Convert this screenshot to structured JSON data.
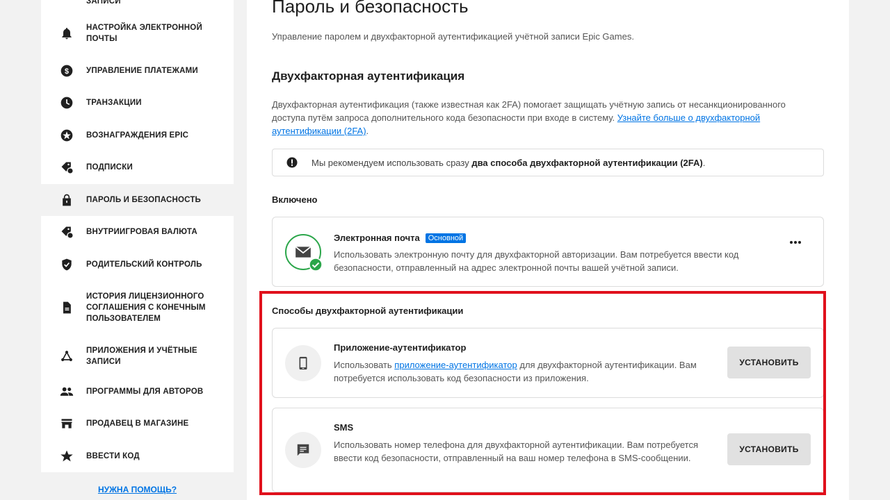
{
  "sidebar": {
    "items": [
      {
        "label": "Настройка электронной почты",
        "icon": "bell-icon"
      },
      {
        "label": "Управление платежами",
        "icon": "dollar-circle-icon"
      },
      {
        "label": "Транзакции",
        "icon": "clock-icon"
      },
      {
        "label": "Вознаграждения Epic",
        "icon": "rewards-icon"
      },
      {
        "label": "Подписки",
        "icon": "subscription-tag-icon"
      },
      {
        "label": "Пароль и безопасность",
        "icon": "lock-icon",
        "active": true
      },
      {
        "label": "Внутриигровая валюта",
        "icon": "currency-tag-icon"
      },
      {
        "label": "Родительский контроль",
        "icon": "shield-check-icon"
      },
      {
        "label": "История лицензионного соглашения с конечным пользователем",
        "icon": "document-icon"
      },
      {
        "label": "Приложения и учётные записи",
        "icon": "connections-icon"
      },
      {
        "label": "Программы для авторов",
        "icon": "people-icon"
      },
      {
        "label": "Продавец в магазине",
        "icon": "store-icon"
      },
      {
        "label": "Ввести код",
        "icon": "star-icon"
      }
    ],
    "help_link": "Нужна помощь?"
  },
  "main": {
    "title": "Пароль и безопасность",
    "subtitle": "Управление паролем и двухфакторной аутентификацией учётной записи Epic Games.",
    "twofa_title": "Двухфакторная аутентификация",
    "twofa_desc": "Двухфакторная аутентификация (также известная как 2FA) помогает защищать учётную запись от несанкционированного доступа путём запроса дополнительного кода безопасности при входе в систему.",
    "twofa_link": "Узнайте больше о двухфакторной аутентификации (2FA)",
    "notice_prefix": "Мы рекомендуем использовать сразу",
    "notice_bold": "два способа двухфакторной аутентификации (2FA)",
    "enabled_label": "Включено",
    "email_method": {
      "title": "Электронная почта",
      "badge": "Основной",
      "desc": "Использовать электронную почту для двухфакторной авторизации. Вам потребуется ввести код безопасности, отправленный на адрес электронной почты вашей учётной записи.",
      "status_color": "#2ba64a"
    },
    "methods_label": "Способы двухфакторной аутентификации",
    "methods": [
      {
        "title": "Приложение-аутентификатор",
        "desc_prefix": "Использовать",
        "desc_link": "приложение-аутентификатор",
        "desc_suffix": "для двухфакторной аутентификации. Вам потребуется использовать код безопасности из приложения.",
        "button": "Установить",
        "icon": "tablet-icon"
      },
      {
        "title": "SMS",
        "desc": "Использовать номер телефона для двухфакторной аутентификации. Вам потребуется ввести код безопасности, отправленный на ваш номер телефона в SMS-сообщении.",
        "button": "Установить",
        "icon": "message-icon"
      }
    ]
  },
  "colors": {
    "accent": "#0074e4",
    "highlight": "#e0101c"
  }
}
